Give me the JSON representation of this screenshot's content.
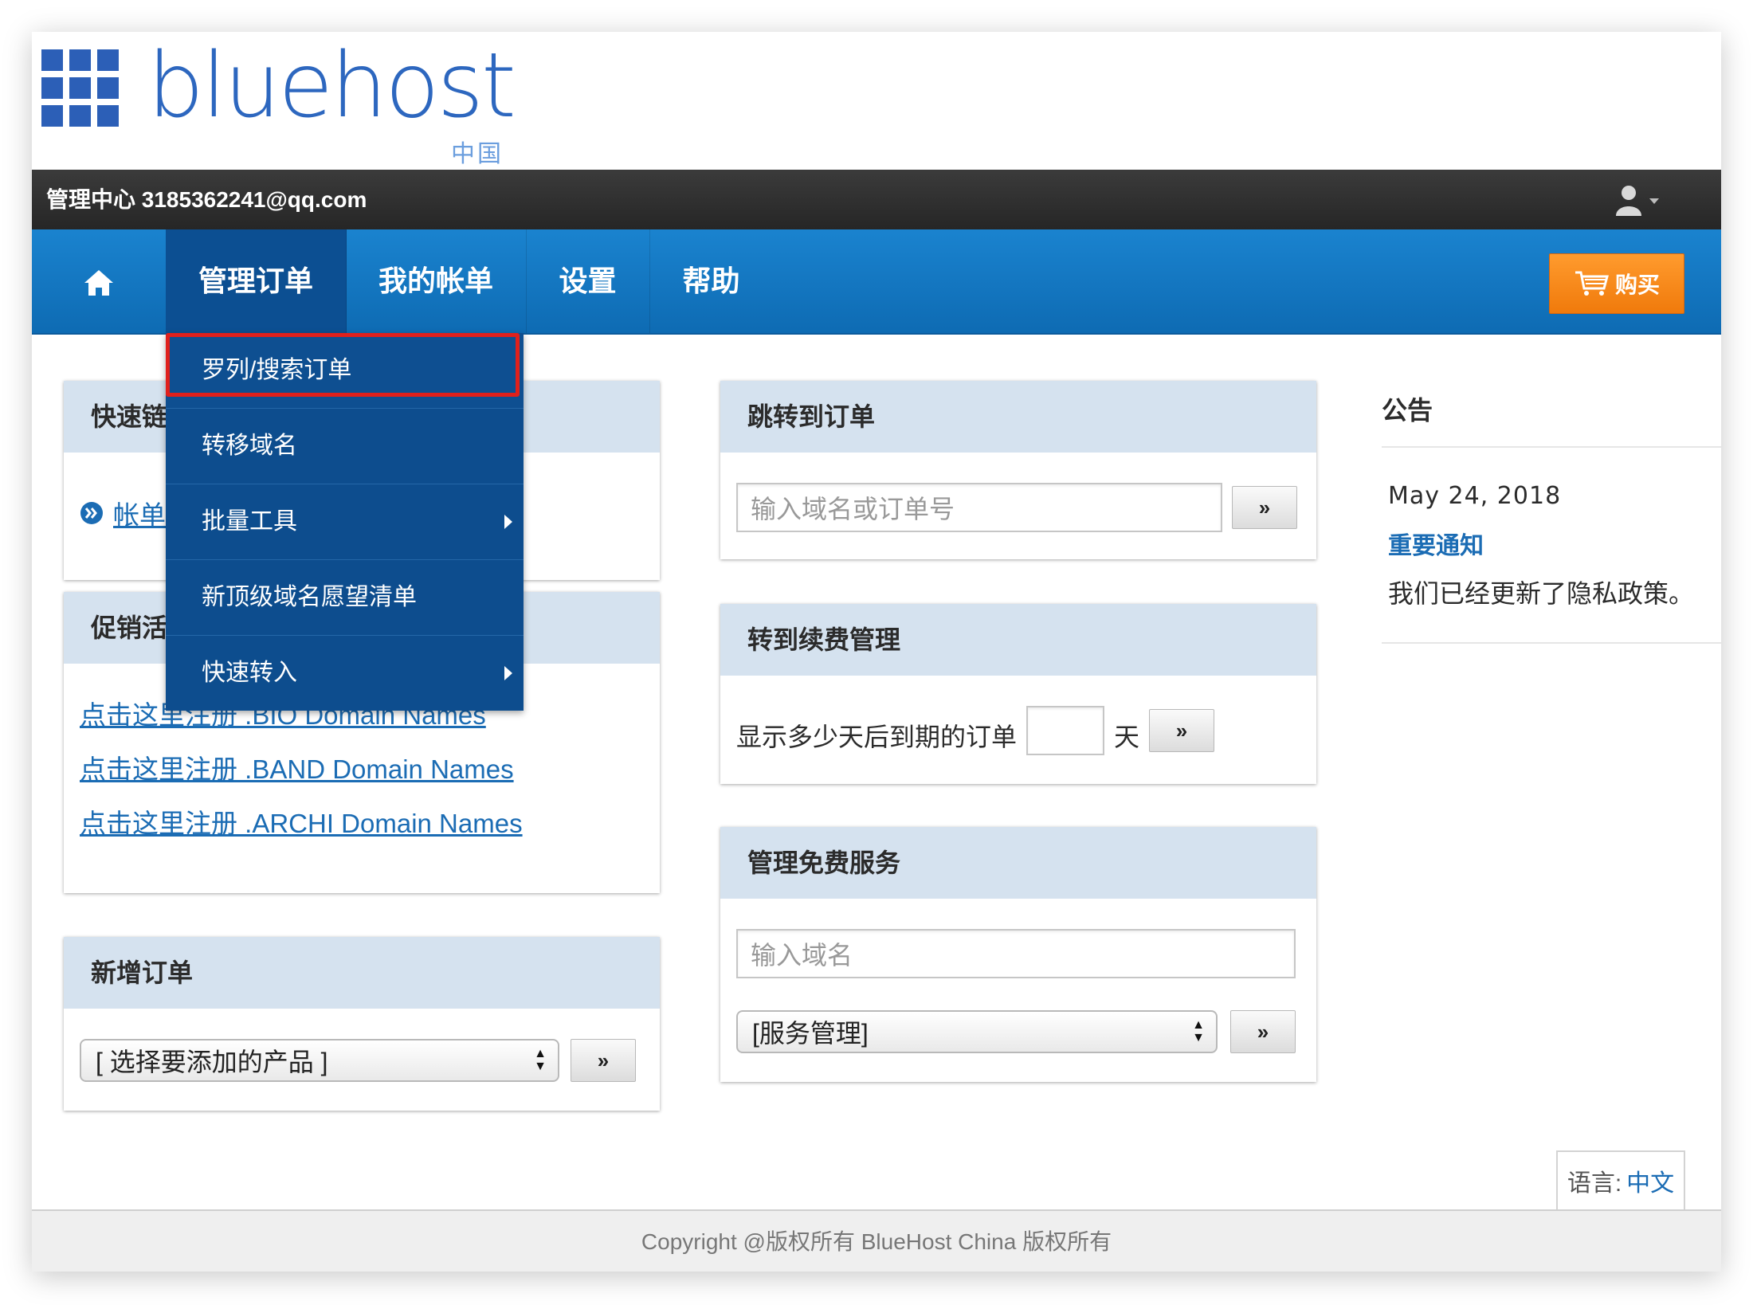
{
  "logo": {
    "text": "bluehost",
    "sub": "中国"
  },
  "topbar": {
    "title": "管理中心 3185362241@qq.com"
  },
  "nav": {
    "home_icon": "home-icon",
    "items": [
      {
        "label": "管理订单"
      },
      {
        "label": "我的帐单"
      },
      {
        "label": "设置"
      },
      {
        "label": "帮助"
      }
    ],
    "buy_label": "购买"
  },
  "dropdown": {
    "items": [
      {
        "label": "罗列/搜索订单",
        "has_submenu": false
      },
      {
        "label": "转移域名",
        "has_submenu": false
      },
      {
        "label": "批量工具",
        "has_submenu": true
      },
      {
        "label": "新顶级域名愿望清单",
        "has_submenu": false
      },
      {
        "label": "快速转入",
        "has_submenu": true
      }
    ]
  },
  "quick_links": {
    "title": "快速链",
    "link": "帐单"
  },
  "promo": {
    "title": "促销活",
    "links": [
      "点击这里注册 .BIO Domain Names",
      "点击这里注册 .BAND Domain Names",
      "点击这里注册 .ARCHI Domain Names"
    ]
  },
  "new_order": {
    "title": "新增订单",
    "select_value": "[ 选择要添加的产品 ]",
    "go_label": "»"
  },
  "jump_order": {
    "title": "跳转到订单",
    "placeholder": "输入域名或订单号",
    "go_label": "»"
  },
  "renewal": {
    "title": "转到续费管理",
    "prefix": "显示多少天后到期的订单",
    "suffix": "天",
    "go_label": "»"
  },
  "free_services": {
    "title": "管理免费服务",
    "placeholder": "输入域名",
    "select_value": "[服务管理]",
    "go_label": "»"
  },
  "announcements": {
    "title": "公告",
    "date": "May 24, 2018",
    "headline": "重要通知",
    "text": "我们已经更新了隐私政策。"
  },
  "language": {
    "label": "语言:",
    "value": "中文"
  },
  "footer": {
    "copyright": "Copyright @版权所有 BlueHost China 版权所有"
  },
  "colors": {
    "nav_blue": "#1a83cf",
    "dropdown_blue": "#0d4d8e",
    "buy_orange": "#f7891c",
    "highlight_red": "#e0201c",
    "link_blue": "#1b6cb4"
  }
}
